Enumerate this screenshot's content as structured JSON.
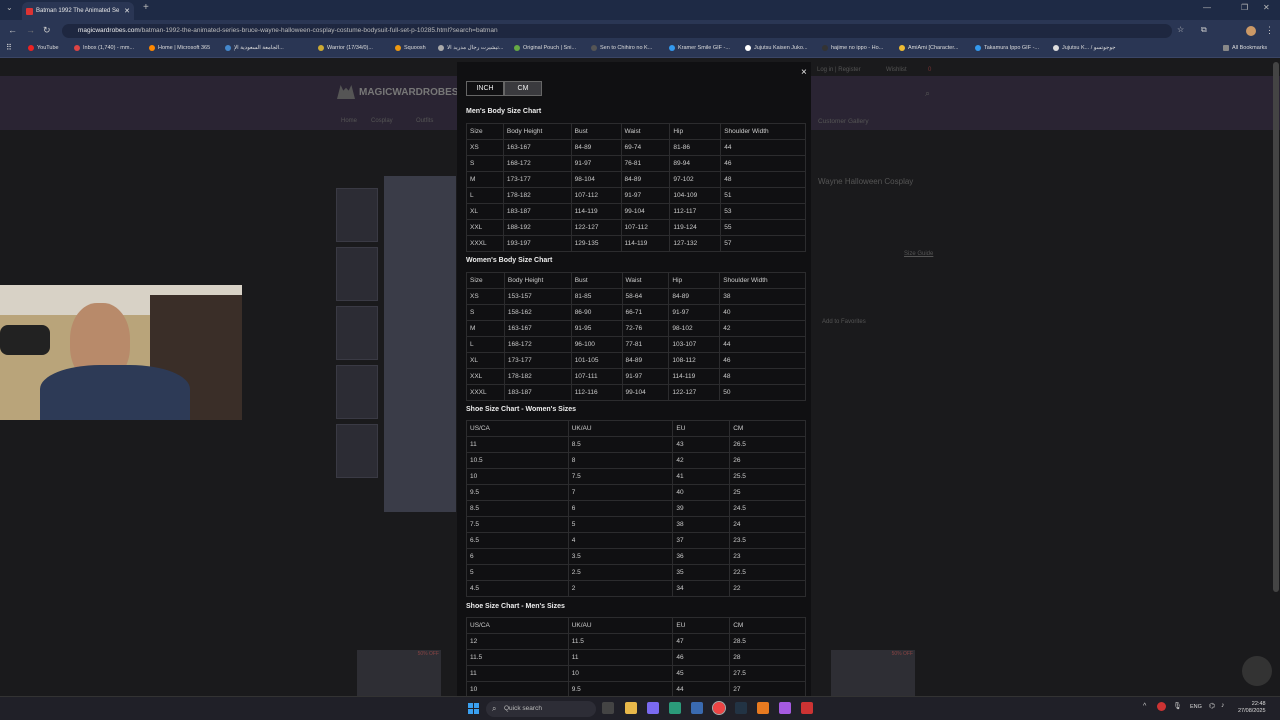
{
  "browser": {
    "tab_title": "Batman 1992 The Animated Se",
    "new_tab": "+",
    "close_tab": "✕",
    "url_domain": "magicwardrobes.com",
    "url_path": "/batman-1992-the-animated-series-bruce-wayne-halloween-cosplay-costume-bodysuit-full-set-p-10285.html?search=batman",
    "bookmarks": [
      "YouTube",
      "Inbox (1,740) - mm...",
      "Home | Microsoft 365",
      "الجامعة السعودية الإ...",
      "Warrior (17/34/0)...",
      "Squoosh",
      "تيشيرت رجال مدريد الا...",
      "Original Pouch | Sni...",
      "Sen to Chihiro no K...",
      "Kramer Smile GIF -...",
      "Jujutsu Kaisen Juko...",
      "hajime no ippo - Ho...",
      "AmiAmi [Character...",
      "Takamura Ippo GIF -...",
      "Jujutsu K... / جوجوتسو"
    ],
    "all_bookmarks": "All Bookmarks"
  },
  "site": {
    "logo": "MAGICWARDROBES",
    "nav": [
      "Home",
      "Cosplay",
      "Outfits"
    ],
    "login": "Log in | Register",
    "wishlist": "Wishlist",
    "cart": "0",
    "gallery": "Customer Gallery",
    "product_title": "Wayne Halloween Cosplay",
    "size_guide": "Size Guide",
    "add_fav": "Add to Favorites",
    "sale_badge": "50% OFF"
  },
  "modal": {
    "close": "×",
    "unit_inch": "INCH",
    "unit_cm": "CM",
    "mens_title": "Men's Body Size Chart",
    "mens_header": [
      "Size",
      "Body Height",
      "Bust",
      "Waist",
      "Hip",
      "Shoulder Width"
    ],
    "mens_rows": [
      [
        "XS",
        "163-167",
        "84-89",
        "69-74",
        "81-86",
        "44"
      ],
      [
        "S",
        "168-172",
        "91-97",
        "76-81",
        "89-94",
        "46"
      ],
      [
        "M",
        "173-177",
        "98-104",
        "84-89",
        "97-102",
        "48"
      ],
      [
        "L",
        "178-182",
        "107-112",
        "91-97",
        "104-109",
        "51"
      ],
      [
        "XL",
        "183-187",
        "114-119",
        "99-104",
        "112-117",
        "53"
      ],
      [
        "XXL",
        "188-192",
        "122-127",
        "107-112",
        "119-124",
        "55"
      ],
      [
        "XXXL",
        "193-197",
        "129-135",
        "114-119",
        "127-132",
        "57"
      ]
    ],
    "womens_title": "Women's Body Size Chart",
    "womens_header": [
      "Size",
      "Body Height",
      "Bust",
      "Waist",
      "Hip",
      "Shoulder Width"
    ],
    "womens_rows": [
      [
        "XS",
        "153-157",
        "81-85",
        "58-64",
        "84-89",
        "38"
      ],
      [
        "S",
        "158-162",
        "86-90",
        "66-71",
        "91-97",
        "40"
      ],
      [
        "M",
        "163-167",
        "91-95",
        "72-76",
        "98-102",
        "42"
      ],
      [
        "L",
        "168-172",
        "96-100",
        "77-81",
        "103-107",
        "44"
      ],
      [
        "XL",
        "173-177",
        "101-105",
        "84-89",
        "108-112",
        "46"
      ],
      [
        "XXL",
        "178-182",
        "107-111",
        "91-97",
        "114-119",
        "48"
      ],
      [
        "XXXL",
        "183-187",
        "112-116",
        "99-104",
        "122-127",
        "50"
      ]
    ],
    "shoe_w_title": "Shoe Size Chart - Women's Sizes",
    "shoe_header": [
      "US/CA",
      "UK/AU",
      "EU",
      "CM"
    ],
    "shoe_w_rows": [
      [
        "11",
        "8.5",
        "43",
        "26.5"
      ],
      [
        "10.5",
        "8",
        "42",
        "26"
      ],
      [
        "10",
        "7.5",
        "41",
        "25.5"
      ],
      [
        "9.5",
        "7",
        "40",
        "25"
      ],
      [
        "8.5",
        "6",
        "39",
        "24.5"
      ],
      [
        "7.5",
        "5",
        "38",
        "24"
      ],
      [
        "6.5",
        "4",
        "37",
        "23.5"
      ],
      [
        "6",
        "3.5",
        "36",
        "23"
      ],
      [
        "5",
        "2.5",
        "35",
        "22.5"
      ],
      [
        "4.5",
        "2",
        "34",
        "22"
      ]
    ],
    "shoe_m_title": "Shoe Size Chart - Men's Sizes",
    "shoe_m_rows": [
      [
        "12",
        "11.5",
        "47",
        "28.5"
      ],
      [
        "11.5",
        "11",
        "46",
        "28"
      ],
      [
        "11",
        "10",
        "45",
        "27.5"
      ],
      [
        "10",
        "9.5",
        "44",
        "27"
      ]
    ]
  },
  "taskbar": {
    "search_placeholder": "Quick search",
    "lang": "ENG",
    "time": "22:48",
    "date": "27/08/2025"
  }
}
